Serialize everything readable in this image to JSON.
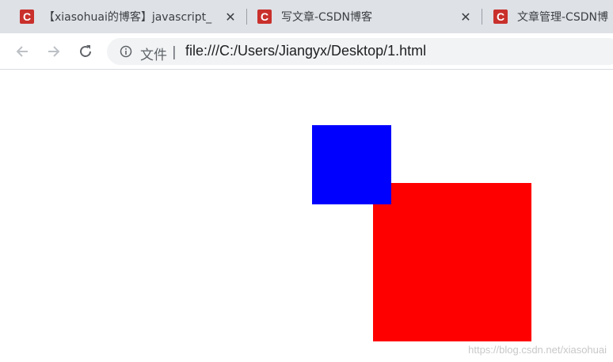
{
  "tabs": [
    {
      "title": "【xiasohuai的博客】javascript_",
      "favicon_letter": "C",
      "close": "✕"
    },
    {
      "title": "写文章-CSDN博客",
      "favicon_letter": "C",
      "close": "✕"
    },
    {
      "title": "文章管理-CSDN博",
      "favicon_letter": "C"
    }
  ],
  "toolbar": {
    "back_icon": "arrow-left-icon",
    "forward_icon": "arrow-right-icon",
    "reload_icon": "reload-icon",
    "scheme_label": "文件",
    "scheme_separator": "|",
    "url": "file:///C:/Users/Jiangyx/Desktop/1.html"
  },
  "page": {
    "red_box_color": "#ff0000",
    "blue_box_color": "#0000ff",
    "watermark": "https://blog.csdn.net/xiasohuai"
  },
  "colors": {
    "tabstrip_bg": "#dee1e6",
    "favicon": "#c9302c",
    "omnibox_bg": "#f1f3f4"
  }
}
